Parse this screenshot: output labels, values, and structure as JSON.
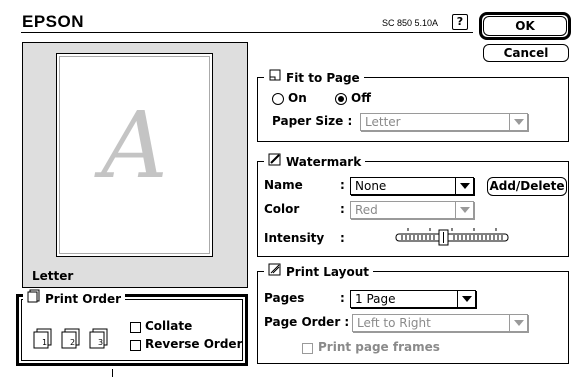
{
  "header": {
    "brand": "EPSON",
    "version": "SC 850 5.10A",
    "help_icon": "help-question-icon"
  },
  "buttons": {
    "ok": "OK",
    "cancel": "Cancel"
  },
  "preview": {
    "page_letter": "A",
    "paper_label": "Letter"
  },
  "print_order": {
    "title": "Print Order",
    "collate": "Collate",
    "reverse_order": "Reverse Order",
    "collate_checked": false,
    "reverse_checked": false
  },
  "fit_to_page": {
    "title": "Fit to Page",
    "on_label": "On",
    "off_label": "Off",
    "selected": "Off",
    "paper_size_label": "Paper Size :",
    "paper_size_value": "Letter"
  },
  "watermark": {
    "title": "Watermark",
    "name_label": "Name",
    "name_value": "None",
    "add_delete": "Add/Delete",
    "color_label": "Color",
    "color_value": "Red",
    "intensity_label": "Intensity",
    "colon": ":",
    "intensity_level": 0.4
  },
  "print_layout": {
    "title": "Print Layout",
    "pages_label": "Pages",
    "pages_value": "1 Page",
    "page_order_label": "Page Order :",
    "page_order_value": "Left to Right",
    "print_frames": "Print page frames"
  }
}
